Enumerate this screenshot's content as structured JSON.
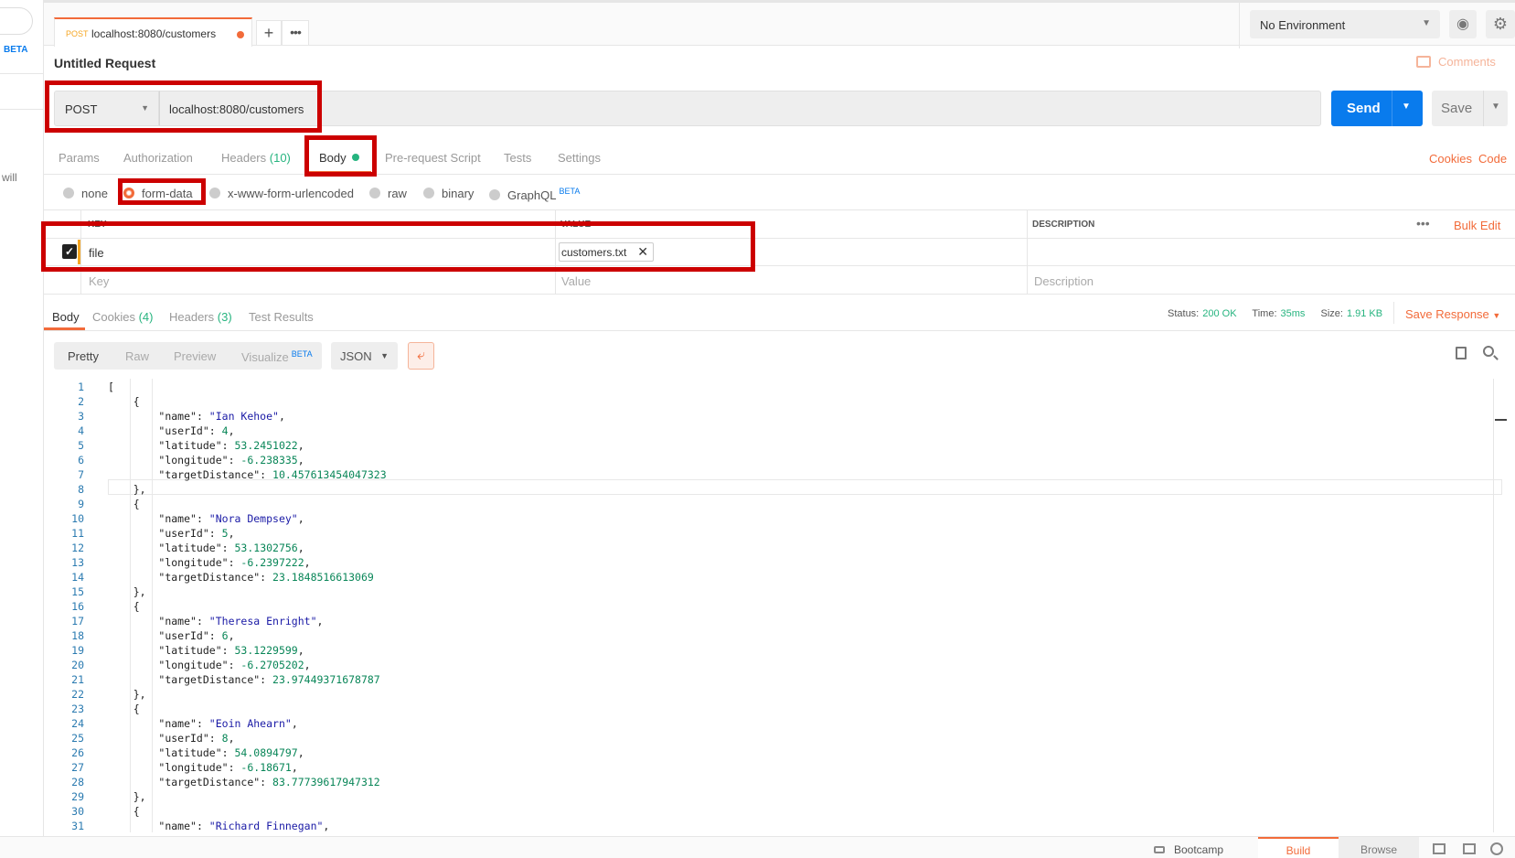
{
  "sidebar": {
    "beta_label": "BETA",
    "partial_text": "will"
  },
  "tabs": [
    {
      "method": "POST",
      "url": "localhost:8080/customers"
    }
  ],
  "new_tab_label": "+",
  "tab_more_label": "•••",
  "environment": {
    "selected": "No Environment"
  },
  "request": {
    "title": "Untitled Request",
    "comments_label": "Comments",
    "method": "POST",
    "url": "localhost:8080/customers",
    "send_label": "Send",
    "save_label": "Save"
  },
  "request_tabs": {
    "params": "Params",
    "authorization": "Authorization",
    "headers": "Headers",
    "headers_count": "(10)",
    "body": "Body",
    "pre_request": "Pre-request Script",
    "tests": "Tests",
    "settings": "Settings",
    "cookies_link": "Cookies",
    "code_link": "Code"
  },
  "body_types": {
    "none": "none",
    "form_data": "form-data",
    "urlencoded": "x-www-form-urlencoded",
    "raw": "raw",
    "binary": "binary",
    "graphql": "GraphQL",
    "graphql_badge": "BETA",
    "selected": "form-data"
  },
  "form_table": {
    "headers": {
      "key": "KEY",
      "value": "VALUE",
      "description": "DESCRIPTION"
    },
    "bulk_edit": "Bulk Edit",
    "rows": [
      {
        "checked": true,
        "key": "file",
        "value": "customers.txt",
        "description": ""
      }
    ],
    "placeholders": {
      "key": "Key",
      "value": "Value",
      "description": "Description"
    }
  },
  "response_tabs": {
    "body": "Body",
    "cookies": "Cookies",
    "cookies_count": "(4)",
    "headers": "Headers",
    "headers_count": "(3)",
    "test_results": "Test Results"
  },
  "response_status": {
    "status_label": "Status:",
    "status": "200 OK",
    "time_label": "Time:",
    "time": "35ms",
    "size_label": "Size:",
    "size": "1.91 KB",
    "save_response": "Save Response"
  },
  "view_modes": {
    "pretty": "Pretty",
    "raw": "Raw",
    "preview": "Preview",
    "visualize": "Visualize",
    "visualize_badge": "BETA",
    "format": "JSON"
  },
  "response_lines": [
    "[",
    "    {",
    "        \"name\": \"Ian Kehoe\",",
    "        \"userId\": 4,",
    "        \"latitude\": 53.2451022,",
    "        \"longitude\": -6.238335,",
    "        \"targetDistance\": 10.457613454047323",
    "    },",
    "    {",
    "        \"name\": \"Nora Dempsey\",",
    "        \"userId\": 5,",
    "        \"latitude\": 53.1302756,",
    "        \"longitude\": -6.2397222,",
    "        \"targetDistance\": 23.1848516613069",
    "    },",
    "    {",
    "        \"name\": \"Theresa Enright\",",
    "        \"userId\": 6,",
    "        \"latitude\": 53.1229599,",
    "        \"longitude\": -6.2705202,",
    "        \"targetDistance\": 23.97449371678787",
    "    },",
    "    {",
    "        \"name\": \"Eoin Ahearn\",",
    "        \"userId\": 8,",
    "        \"latitude\": 54.0894797,",
    "        \"longitude\": -6.18671,",
    "        \"targetDistance\": 83.77739617947312",
    "    },",
    "    {",
    "        \"name\": \"Richard Finnegan\","
  ],
  "status_bar": {
    "bootcamp": "Bootcamp",
    "build": "Build",
    "browse": "Browse"
  },
  "colors": {
    "accent": "#f26b3a",
    "send": "#097bed",
    "success": "#26b47f",
    "highlight": "#cc0000"
  }
}
